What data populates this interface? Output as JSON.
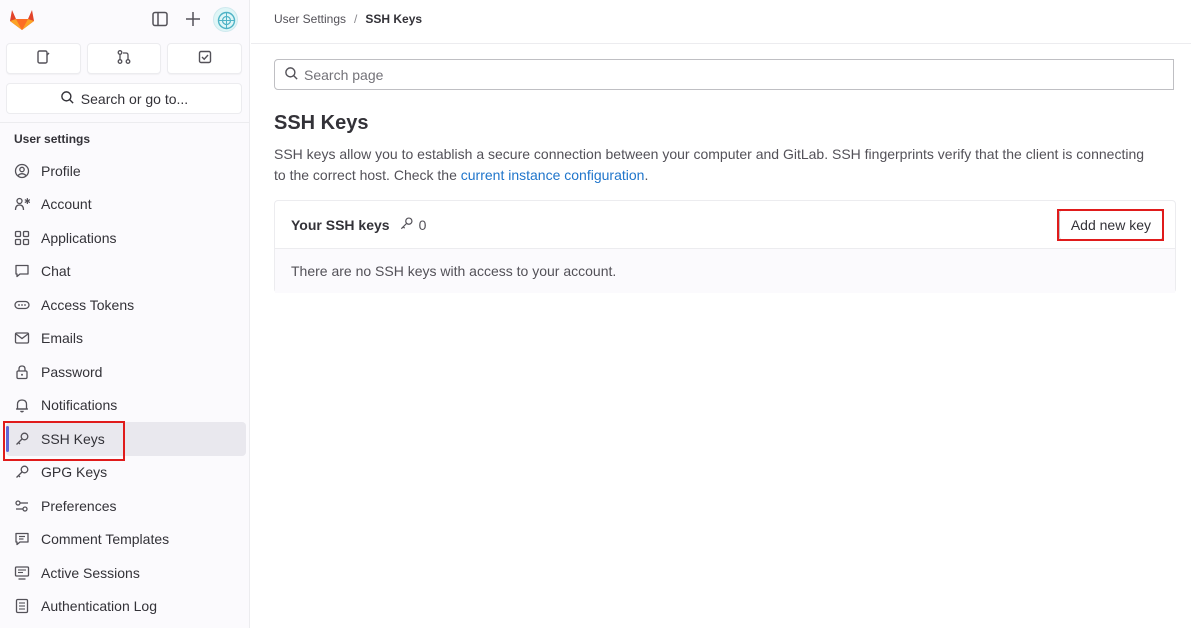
{
  "top": {
    "logo_icon": "gitlab-logo-icon",
    "sidebar_toggle_icon": "sidebar-toggle-icon",
    "new_icon": "plus-icon",
    "avatar_icon": "user-avatar"
  },
  "quick_buttons": [
    {
      "name": "issues-button",
      "icon": "issues-icon"
    },
    {
      "name": "merge-requests-button",
      "icon": "merge-request-icon"
    },
    {
      "name": "todos-button",
      "icon": "todo-icon"
    }
  ],
  "sidebar": {
    "search_label": "Search or go to...",
    "section_heading": "User settings",
    "items": [
      {
        "label": "Profile",
        "icon": "profile-icon"
      },
      {
        "label": "Account",
        "icon": "account-icon"
      },
      {
        "label": "Applications",
        "icon": "applications-icon"
      },
      {
        "label": "Chat",
        "icon": "chat-icon"
      },
      {
        "label": "Access Tokens",
        "icon": "token-icon"
      },
      {
        "label": "Emails",
        "icon": "mail-icon"
      },
      {
        "label": "Password",
        "icon": "lock-icon"
      },
      {
        "label": "Notifications",
        "icon": "bell-icon"
      },
      {
        "label": "SSH Keys",
        "icon": "key-icon",
        "active": true
      },
      {
        "label": "GPG Keys",
        "icon": "key-icon"
      },
      {
        "label": "Preferences",
        "icon": "preferences-icon"
      },
      {
        "label": "Comment Templates",
        "icon": "comment-icon"
      },
      {
        "label": "Active Sessions",
        "icon": "monitor-icon"
      },
      {
        "label": "Authentication Log",
        "icon": "log-icon"
      }
    ]
  },
  "breadcrumb": {
    "parent": "User Settings",
    "separator": "/",
    "current": "SSH Keys"
  },
  "search": {
    "placeholder": "Search page"
  },
  "page": {
    "title": "SSH Keys",
    "description_prefix": "SSH keys allow you to establish a secure connection between your computer and GitLab. SSH fingerprints verify that the client is connecting to the correct host. Check the ",
    "description_link": "current instance configuration",
    "description_suffix": "."
  },
  "card": {
    "title": "Your SSH keys",
    "count": "0",
    "add_button_label": "Add new key",
    "empty_text": "There are no SSH keys with access to your account."
  },
  "colors": {
    "accent": "#6166d6",
    "link": "#1f75cb",
    "highlight": "#e01b1b"
  }
}
